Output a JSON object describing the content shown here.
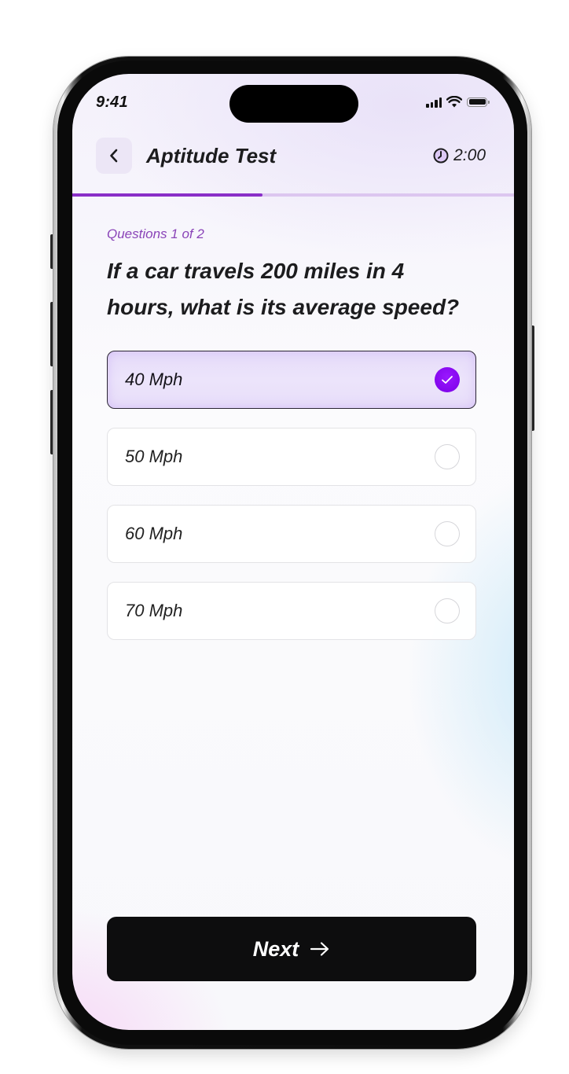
{
  "status_bar": {
    "time": "9:41",
    "icons": [
      "signal-icon",
      "wifi-icon",
      "battery-icon"
    ]
  },
  "header": {
    "back_icon": "chevron-left-icon",
    "title": "Aptitude Test",
    "timer_icon": "clock-icon",
    "timer": "2:00"
  },
  "progress": {
    "fraction": 0.43,
    "fill_color": "#8a2fc8",
    "track_color": "#dcc6f0"
  },
  "quiz": {
    "counter": "Questions 1 of 2",
    "question": "If a car travels 200 miles in 4 hours, what is its average speed?",
    "options": [
      {
        "label": "40 Mph",
        "selected": true
      },
      {
        "label": "50 Mph",
        "selected": false
      },
      {
        "label": "60 Mph",
        "selected": false
      },
      {
        "label": "70 Mph",
        "selected": false
      }
    ],
    "accent_color": "#8a0cf0"
  },
  "footer": {
    "next_label": "Next",
    "next_icon": "arrow-right-icon"
  }
}
